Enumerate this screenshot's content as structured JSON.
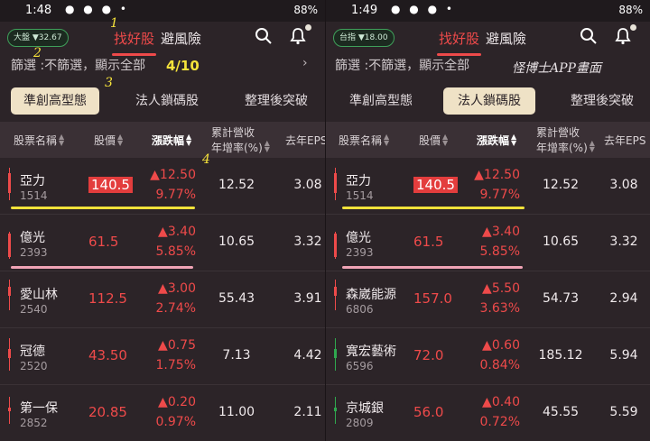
{
  "left": {
    "status_time": "1:48",
    "status_right": "88%",
    "index_label": "大盤 ▼32.67",
    "tab_active": "找好股",
    "tab_other": "避風險",
    "filter_text": "篩選 :不篩選，顯示全部",
    "filter_count": "4/10",
    "chips": [
      "準創高型態",
      "法人鎖碼股",
      "整理後突破"
    ],
    "headers": [
      "股票名稱",
      "股價",
      "漲跌幅",
      "累計營收",
      "年增率(%)",
      "去年EPS"
    ],
    "rows": [
      {
        "name": "亞力",
        "code": "1514",
        "price": "140.5",
        "chg": "▲12.50",
        "pct": "9.77%",
        "rev": "12.52",
        "eps": "3.08"
      },
      {
        "name": "億光",
        "code": "2393",
        "price": "61.5",
        "chg": "▲3.40",
        "pct": "5.85%",
        "rev": "10.65",
        "eps": "3.32"
      },
      {
        "name": "愛山林",
        "code": "2540",
        "price": "112.5",
        "chg": "▲3.00",
        "pct": "2.74%",
        "rev": "55.43",
        "eps": "3.91"
      },
      {
        "name": "冠德",
        "code": "2520",
        "price": "43.50",
        "chg": "▲0.75",
        "pct": "1.75%",
        "rev": "7.13",
        "eps": "4.42"
      },
      {
        "name": "第一保",
        "code": "2852",
        "price": "20.85",
        "chg": "▲0.20",
        "pct": "0.97%",
        "rev": "11.00",
        "eps": "2.11"
      }
    ]
  },
  "right": {
    "status_time": "1:49",
    "status_right": "88%",
    "index_label": "台指 ▼18.00",
    "tab_active": "找好股",
    "tab_other": "避風險",
    "filter_text": "篩選 :不篩選，顯示全部",
    "watermark": "怪博士APP畫面",
    "chips": [
      "準創高型態",
      "法人鎖碼股",
      "整理後突破"
    ],
    "headers": [
      "股票名稱",
      "股價",
      "漲跌幅",
      "累計營收",
      "年增率(%)",
      "去年EPS"
    ],
    "rows": [
      {
        "name": "亞力",
        "code": "1514",
        "price": "140.5",
        "chg": "▲12.50",
        "pct": "9.77%",
        "rev": "12.52",
        "eps": "3.08"
      },
      {
        "name": "億光",
        "code": "2393",
        "price": "61.5",
        "chg": "▲3.40",
        "pct": "5.85%",
        "rev": "10.65",
        "eps": "3.32"
      },
      {
        "name": "森崴能源",
        "code": "6806",
        "price": "157.0",
        "chg": "▲5.50",
        "pct": "3.63%",
        "rev": "54.73",
        "eps": "2.94"
      },
      {
        "name": "寬宏藝術",
        "code": "6596",
        "price": "72.0",
        "chg": "▲0.60",
        "pct": "0.84%",
        "rev": "185.12",
        "eps": "5.94"
      },
      {
        "name": "京城銀",
        "code": "2809",
        "price": "56.0",
        "chg": "▲0.40",
        "pct": "0.72%",
        "rev": "45.55",
        "eps": "5.59"
      }
    ]
  },
  "annotations": {
    "n1": "1",
    "n2": "2",
    "n3": "3",
    "n4": "4"
  },
  "colors": {
    "up": "#ee4a4a",
    "down": "#2fa84f",
    "chip_active": "#efe2c6",
    "highlight_yellow": "#f2e23a",
    "highlight_pink": "#f0a4b6"
  }
}
